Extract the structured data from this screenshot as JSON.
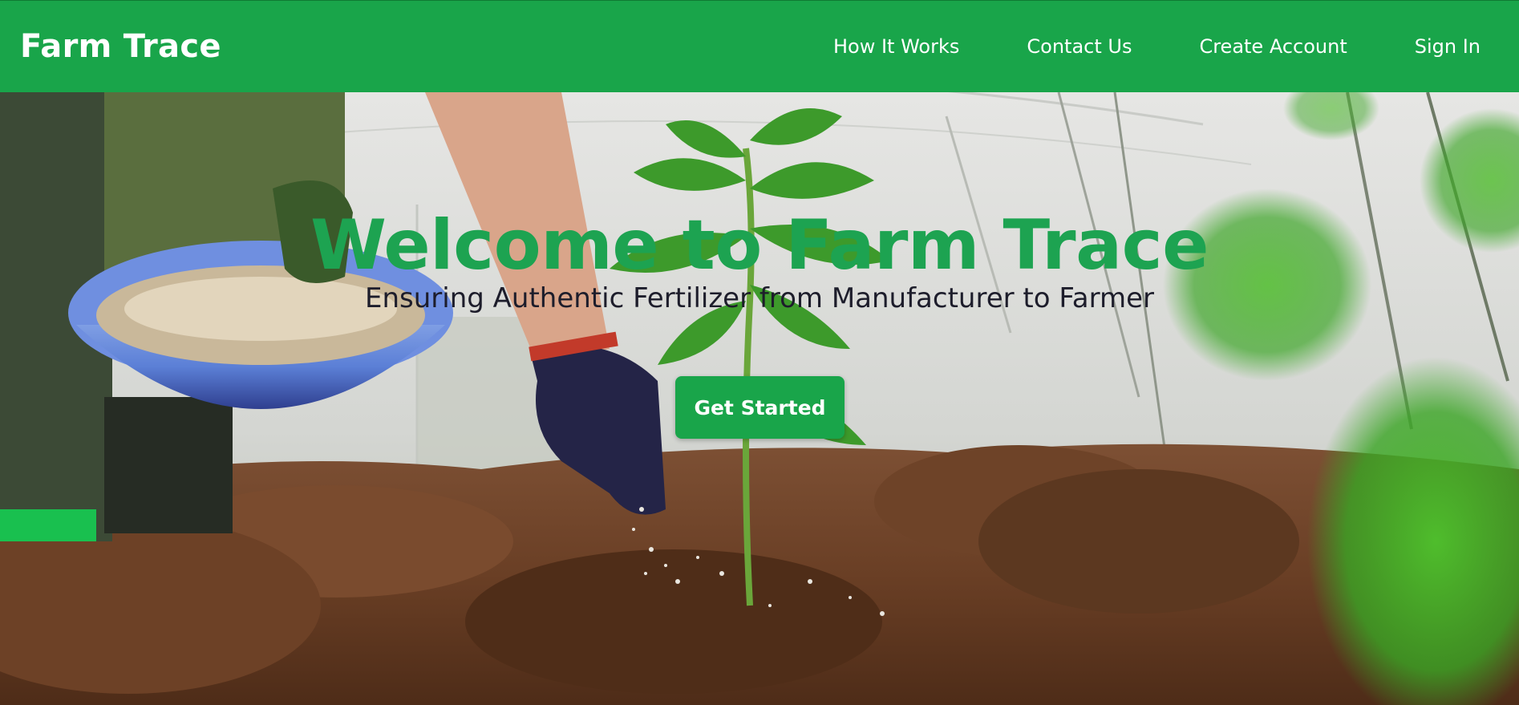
{
  "navbar": {
    "brand": "Farm Trace",
    "links": [
      {
        "label": "How It Works"
      },
      {
        "label": "Contact Us"
      },
      {
        "label": "Create Account"
      },
      {
        "label": "Sign In"
      }
    ]
  },
  "hero": {
    "title": "Welcome to Farm Trace",
    "subtitle": "Ensuring Authentic Fertilizer from Manufacturer to Farmer",
    "cta_label": "Get Started",
    "image": "farmer-planting-seedling-photo"
  },
  "colors": {
    "brand_green": "#19a54a",
    "title_green": "#1da351",
    "subtitle_text": "#1d1d2b",
    "nav_text": "#ffffff"
  }
}
